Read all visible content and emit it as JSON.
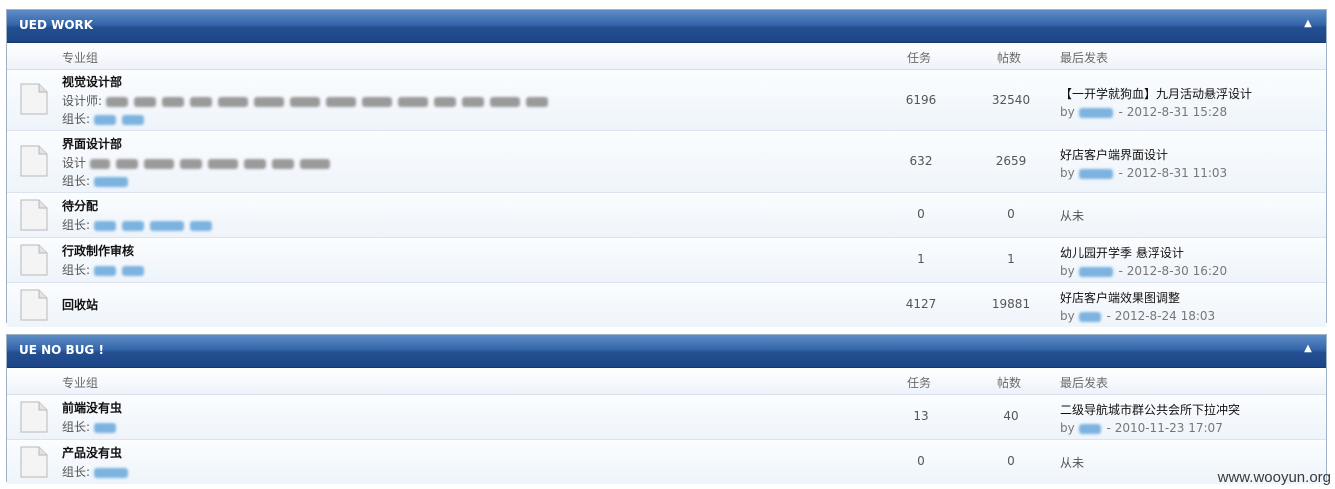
{
  "columns": {
    "forum": "专业组",
    "tasks": "任务",
    "posts": "帖数",
    "last": "最后发表"
  },
  "never": "从未",
  "by": "by",
  "sections": [
    {
      "title": "UED WORK",
      "rows": [
        {
          "name": "视觉设计部",
          "line1_prefix": "设计师:",
          "line2_prefix": "组长:",
          "tasks": "6196",
          "posts": "32540",
          "last_title": "【一开学就狗血】九月活动悬浮设计",
          "last_time": "- 2012-8-31 15:28"
        },
        {
          "name": "界面设计部",
          "line1_prefix": "设计",
          "line2_prefix": "组长:",
          "tasks": "632",
          "posts": "2659",
          "last_title": "好店客户端界面设计",
          "last_time": "- 2012-8-31 11:03"
        },
        {
          "name": "待分配",
          "line2_prefix": "组长:",
          "tasks": "0",
          "posts": "0"
        },
        {
          "name": "行政制作审核",
          "line2_prefix": "组长:",
          "tasks": "1",
          "posts": "1",
          "last_title": "幼儿园开学季 悬浮设计",
          "last_time": "- 2012-8-30 16:20"
        },
        {
          "name": "回收站",
          "tasks": "4127",
          "posts": "19881",
          "last_title": "好店客户端效果图调整",
          "last_time": "- 2012-8-24 18:03"
        }
      ]
    },
    {
      "title": "UE NO BUG !",
      "rows": [
        {
          "name": "前端没有虫",
          "line2_prefix": "组长:",
          "tasks": "13",
          "posts": "40",
          "last_title": "二级导航城市群公共会所下拉冲突",
          "last_time": "- 2010-11-23 17:07"
        },
        {
          "name": "产品没有虫",
          "line2_prefix": "组长:",
          "tasks": "0",
          "posts": "0"
        }
      ]
    }
  ],
  "watermark": "www.wooyun.org",
  "icons": {
    "collapse": "chevron-up-icon",
    "forum": "document-icon"
  },
  "colors": {
    "header_dark": "#1c4585",
    "header_light": "#5e8cc6",
    "link_blur": "#7db3e0"
  }
}
